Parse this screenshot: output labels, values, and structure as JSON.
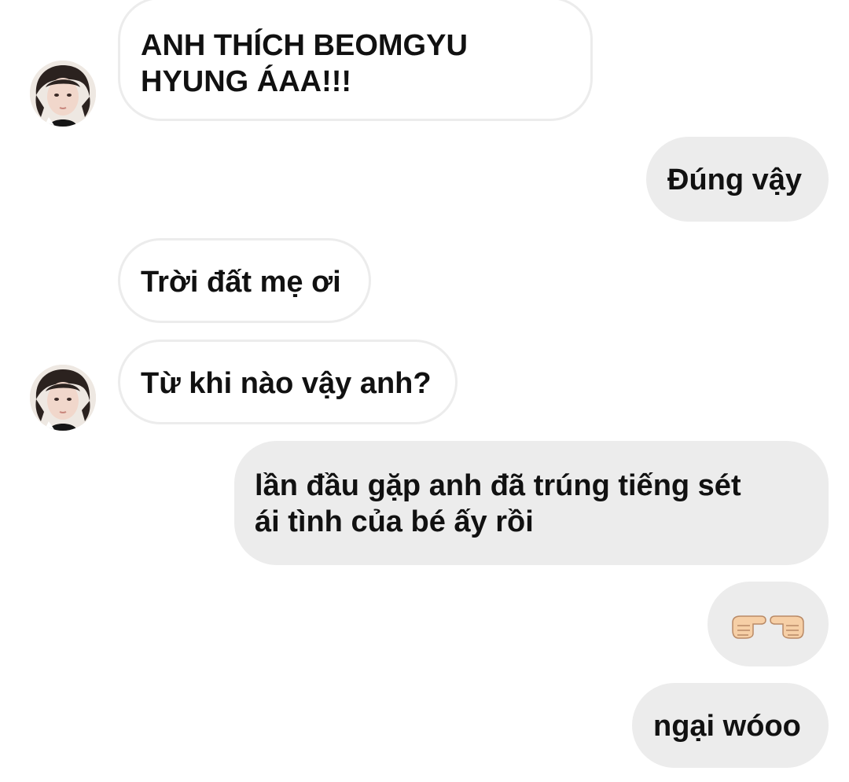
{
  "messages": [
    {
      "sender": "them",
      "text": "ANH THÍCH BEOMGYU\nHYUNG ÁAA!!!"
    },
    {
      "sender": "me",
      "text": "Đúng vậy"
    },
    {
      "sender": "them",
      "text": "Trời đất mẹ ơi"
    },
    {
      "sender": "them",
      "text": "Từ khi nào vậy anh?"
    },
    {
      "sender": "me",
      "text": "lần đầu gặp anh đã trúng tiếng sét\nái tình của bé ấy rồi"
    },
    {
      "sender": "me",
      "text": "👉👈",
      "icon": "pointing-fingers-icon"
    },
    {
      "sender": "me",
      "text": "ngại wóoo"
    }
  ],
  "colors": {
    "outgoing_bubble": "#ececec",
    "incoming_border": "#ececec",
    "text": "#111111"
  },
  "avatars": [
    {
      "icon": "contact-avatar"
    },
    {
      "icon": "contact-avatar"
    }
  ]
}
